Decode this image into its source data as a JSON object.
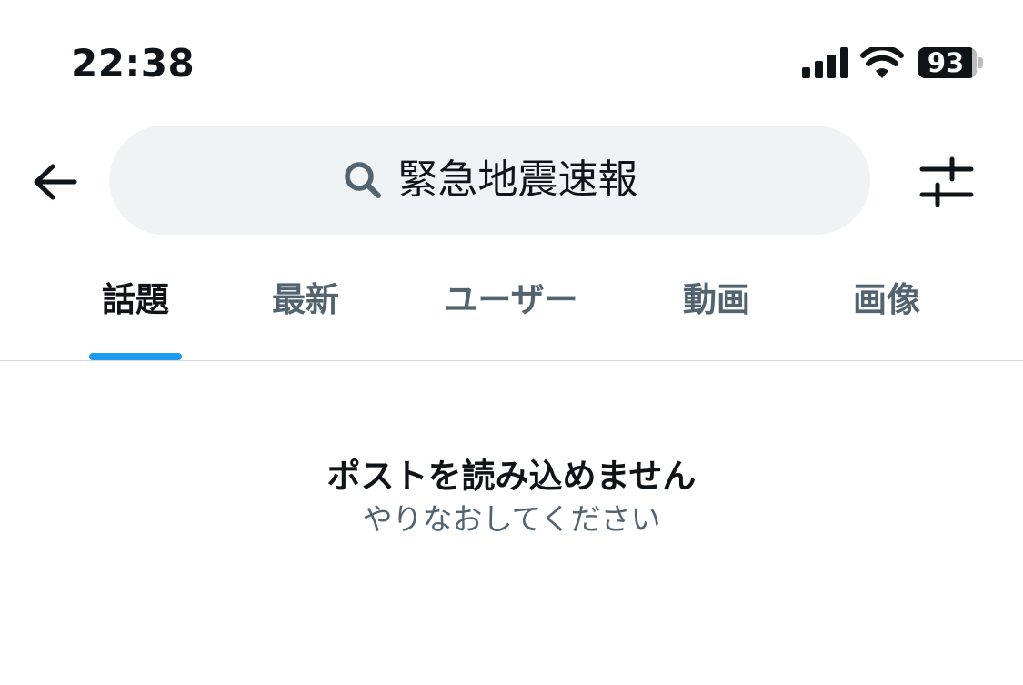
{
  "status_bar": {
    "time": "22:38",
    "signal_icon": "cellular-signal-icon",
    "wifi_icon": "wifi-icon",
    "battery_percent": "93",
    "battery_level": 0.93
  },
  "header": {
    "back_icon": "arrow-left-icon",
    "search_icon": "search-icon",
    "search_query": "緊急地震速報",
    "filter_icon": "sliders-icon"
  },
  "tabs": [
    {
      "label": "話題",
      "active": true
    },
    {
      "label": "最新",
      "active": false
    },
    {
      "label": "ユーザー",
      "active": false
    },
    {
      "label": "動画",
      "active": false
    },
    {
      "label": "画像",
      "active": false
    }
  ],
  "empty_state": {
    "title": "ポストを読み込めません",
    "subtitle": "やりなおしてください"
  },
  "colors": {
    "text_primary": "#0f1419",
    "text_secondary": "#536471",
    "accent": "#1d9bf0",
    "search_background": "#eff3f4",
    "divider": "#cfd9de"
  }
}
